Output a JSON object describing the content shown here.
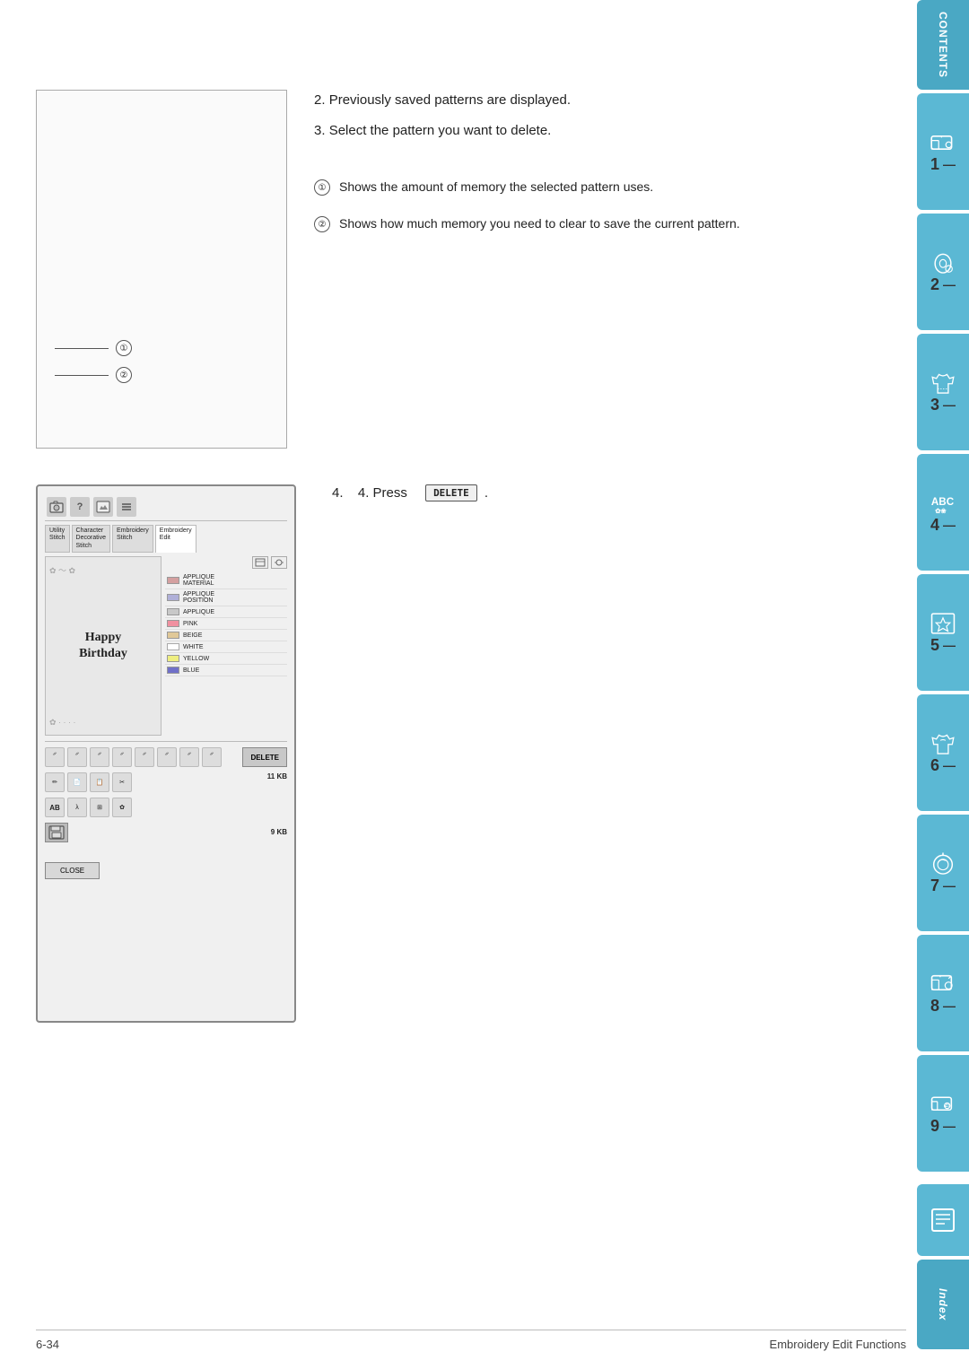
{
  "page": {
    "footer_left": "6-34",
    "footer_center": "Embroidery Edit Functions"
  },
  "instructions": {
    "step2": "Previously saved patterns are displayed.",
    "step3": "Select the pattern you want to delete.",
    "annotation1": "Shows the amount of memory the selected pattern uses.",
    "annotation2": "Shows how much memory you need to clear to save the current pattern.",
    "step4_prefix": "4.  Press",
    "step4_suffix": "."
  },
  "delete_button": {
    "label": "DELETE"
  },
  "screen": {
    "tabs": [
      {
        "label": "Utility\nStitch",
        "active": false
      },
      {
        "label": "Character\nDecorative\nStitch",
        "active": false
      },
      {
        "label": "Embroidery\nStitch",
        "active": false
      },
      {
        "label": "Embroidery\nEdit",
        "active": true
      }
    ],
    "preview_text_line1": "Happy",
    "preview_text_line2": "Birthday",
    "list_items": [
      {
        "color": "#e8a0a0",
        "label": "APPLIQUE\nMATERIAL"
      },
      {
        "color": "#c8c8e8",
        "label": "APPLIQUE\nPOSITION"
      },
      {
        "color": "#d0d0d0",
        "label": "APPLIQUE"
      },
      {
        "color": "#f4a0a0",
        "label": "PINK"
      },
      {
        "color": "#e8d4b0",
        "label": "BEIGE"
      },
      {
        "color": "#ffffff",
        "label": "WHITE"
      },
      {
        "color": "#f0f080",
        "label": "YELLOW"
      },
      {
        "color": "#8080d0",
        "label": "BLUE"
      }
    ],
    "delete_btn": "DELETE",
    "kb_top": "11\nKB",
    "kb_bottom": "9\nKB",
    "close_btn": "CLOSE"
  },
  "sidebar": {
    "contents_label": "CONTENTS",
    "tabs": [
      {
        "number": "1",
        "dash": "—"
      },
      {
        "number": "2",
        "dash": "—"
      },
      {
        "number": "3",
        "dash": "—"
      },
      {
        "number": "4",
        "dash": "—"
      },
      {
        "number": "5",
        "dash": "—"
      },
      {
        "number": "6",
        "dash": "—"
      },
      {
        "number": "7",
        "dash": "—"
      },
      {
        "number": "8",
        "dash": "—"
      },
      {
        "number": "9",
        "dash": "—"
      }
    ],
    "index_label": "Index"
  }
}
